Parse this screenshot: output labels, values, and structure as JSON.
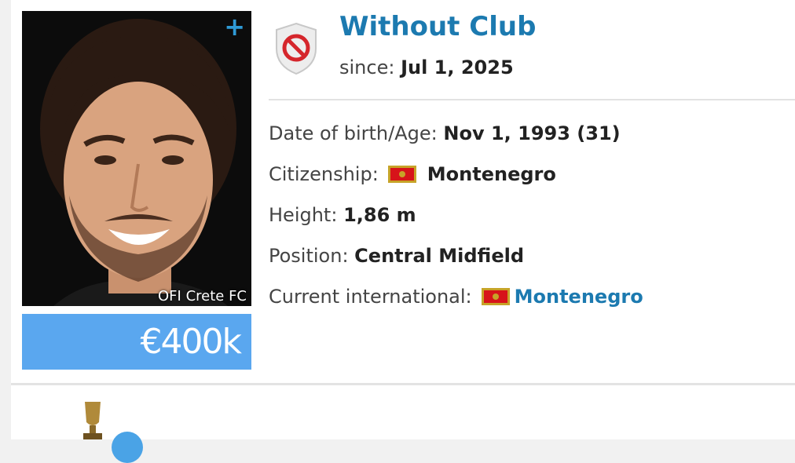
{
  "profile": {
    "photo_credit": "OFI Crete FC",
    "add_icon": "plus-icon",
    "market_value": "€400k"
  },
  "club": {
    "icon": "no-club-icon",
    "name": "Without Club",
    "since_label": "since:",
    "since_value": "Jul 1, 2025"
  },
  "details": {
    "dob_label": "Date of birth/Age:",
    "dob_value": "Nov 1, 1993 (31)",
    "citizenship_label": "Citizenship:",
    "citizenship_value": "Montenegro",
    "height_label": "Height:",
    "height_value": "1,86 m",
    "position_label": "Position:",
    "position_value": "Central Midfield",
    "international_label": "Current international:",
    "international_value": "Montenegro",
    "flag_icon": "montenegro-flag-icon"
  },
  "colors": {
    "link": "#1c7ab0",
    "value_box": "#5aa7ef",
    "flag_red": "#d7141a",
    "flag_gold": "#c7a328"
  }
}
